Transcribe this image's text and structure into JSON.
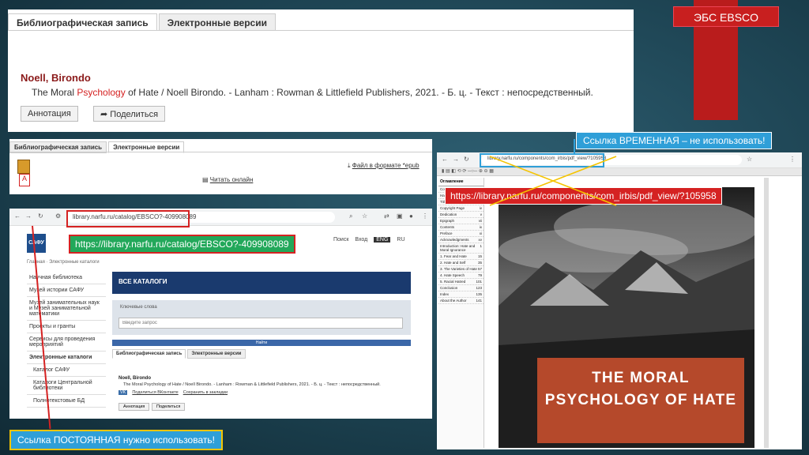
{
  "corner_title": "ЭБС EBSCO",
  "record_panel": {
    "tabs": [
      "Библиографическая запись",
      "Электронные версии"
    ],
    "author": "Noell, Birondo",
    "title_pre": "The Moral ",
    "title_highlight": "Psychology",
    "title_post": " of Hate / Noell Birondo. - Lanham : Rowman & Littlefield Publishers, 2021. - Б. ц. - Текст : непосредственный.",
    "btn_annotation": "Аннотация",
    "btn_share": "Поделиться"
  },
  "versions_panel": {
    "tabs": [
      "Библиографическая запись",
      "Электронные версии"
    ],
    "download_link": "Файл в формате *epub",
    "read_link": "Читать онлайн"
  },
  "catalog_browser": {
    "url": "library.narfu.ru/catalog/EBSCO?-409908089",
    "logo": "САФУ",
    "nav_right": [
      "Поиск",
      "Вход",
      "ENG",
      "RU"
    ],
    "breadcrumb": "Главная · Электронные каталоги",
    "sidebar": [
      "Научная библиотека",
      "Музей истории САФУ",
      "Музей занимательных наук и Музей занимательной математики",
      "Проекты и гранты",
      "Сервисы для проведения мероприятий",
      "Электронные каталоги",
      "Каталог САФУ",
      "Каталоги Центральной библиотеки",
      "Полнотекстовые БД"
    ],
    "banner": "ВСЕ КАТАЛОГИ",
    "search_label": "Ключевые слова",
    "search_placeholder": "Введите запрос",
    "find_button": "Найти",
    "tabs": [
      "Библиографическая запись",
      "Электронные версии"
    ],
    "author": "Noell, Birondo",
    "record": "The Moral Psychology of Hate / Noell Birondo. - Lanham : Rowman & Littlefield Publishers, 2021. - Б. ц. - Текст : непосредственный.",
    "share_vk": "Поделиться ВКонтакте",
    "save_link": "Сохранить в закладки",
    "btn_annotation": "Аннотация",
    "btn_share": "Поделиться"
  },
  "label_permanent_url": "https://library.narfu.ru/catalog/EBSCO?-409908089",
  "label_permanent": "Ссылка ПОСТОЯННАЯ нужно использовать!",
  "reader_browser": {
    "url": "library.narfu.ru/components/com_irbis/pdf_view/?105958",
    "toc_header": "Оглавление",
    "toc": [
      [
        "Cover",
        "i"
      ],
      [
        "Half Title",
        "i"
      ],
      [
        "Title Page",
        "iii"
      ],
      [
        "Copyright Page",
        "iv"
      ],
      [
        "Dedication",
        "v"
      ],
      [
        "Epigraph",
        "vii"
      ],
      [
        "Contents",
        "ix"
      ],
      [
        "Preface",
        "xi"
      ],
      [
        "Acknowledgments",
        "xv"
      ],
      [
        "Introduction: Hate and Moral Ignorance",
        "1"
      ],
      [
        "1. Fear and Hate",
        "15"
      ],
      [
        "2. Hate and Self",
        "35"
      ],
      [
        "3. The Varieties of Hate",
        "57"
      ],
      [
        "4. Hate Speech",
        "79"
      ],
      [
        "5. Racial Hatred",
        "101"
      ],
      [
        "Conclusion",
        "123"
      ],
      [
        "Index",
        "135"
      ],
      [
        "About the Author",
        "141"
      ]
    ],
    "book_title": "THE MORAL PSYCHOLOGY OF HATE"
  },
  "label_temp_url": "https://library.narfu.ru/components/com_irbis/pdf_view/?105958",
  "label_temp": "Ссылка ВРЕМЕННАЯ – не использовать!",
  "colors": {
    "accent_red": "#d52222",
    "label_green": "#22a85a",
    "label_blue": "#2f9fd8",
    "frame_yellow": "#f5c400"
  }
}
